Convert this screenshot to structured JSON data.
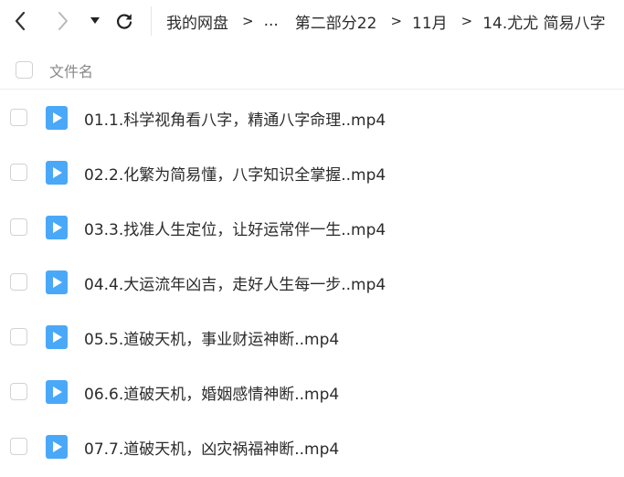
{
  "toolbar": {
    "back_icon": "chevron-left-icon",
    "forward_icon": "chevron-right-icon",
    "history_icon": "caret-down-icon",
    "refresh_icon": "refresh-icon"
  },
  "breadcrumb": {
    "root": "我的网盘",
    "ellipsis": "...",
    "items": [
      "第二部分22",
      "11月",
      "14.尤尤 简易八字"
    ],
    "separator": ">"
  },
  "file_list": {
    "column_name": "文件名",
    "file_icon": "video-file-icon",
    "files": [
      {
        "name": "01.1.科学视角看八字，精通八字命理..mp4"
      },
      {
        "name": "02.2.化繁为简易懂，八字知识全掌握..mp4"
      },
      {
        "name": "03.3.找准人生定位，让好运常伴一生..mp4"
      },
      {
        "name": "04.4.大运流年凶吉，走好人生每一步..mp4"
      },
      {
        "name": "05.5.道破天机，事业财运神断..mp4"
      },
      {
        "name": "06.6.道破天机，婚姻感情神断..mp4"
      },
      {
        "name": "07.7.道破天机，凶灾祸福神断..mp4"
      }
    ]
  },
  "colors": {
    "icon_blue": "#4aa8f8",
    "text": "#2b2b2b",
    "muted": "#888888"
  }
}
